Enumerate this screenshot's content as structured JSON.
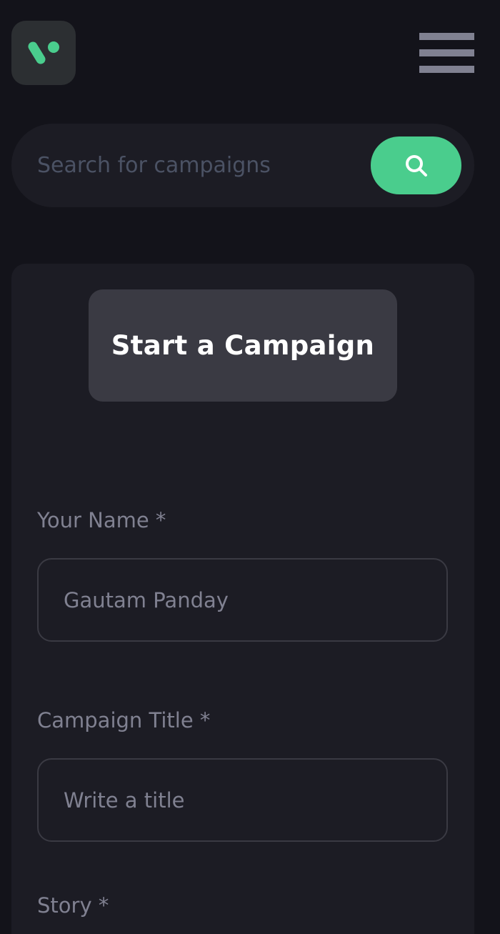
{
  "header": {
    "logo_icon": "app-logo-icon",
    "menu_icon": "hamburger-menu-icon",
    "colors": {
      "background": "#13131a",
      "surface": "#1c1c24",
      "accent": "#4acd8d"
    }
  },
  "search": {
    "placeholder": "Search for campaigns",
    "value": "",
    "button_icon": "search-icon"
  },
  "form": {
    "title": "Start a Campaign",
    "fields": [
      {
        "label": "Your Name *",
        "value": "Gautam Panday",
        "placeholder": ""
      },
      {
        "label": "Campaign Title *",
        "value": "",
        "placeholder": "Write a title"
      },
      {
        "label": "Story *"
      }
    ]
  }
}
